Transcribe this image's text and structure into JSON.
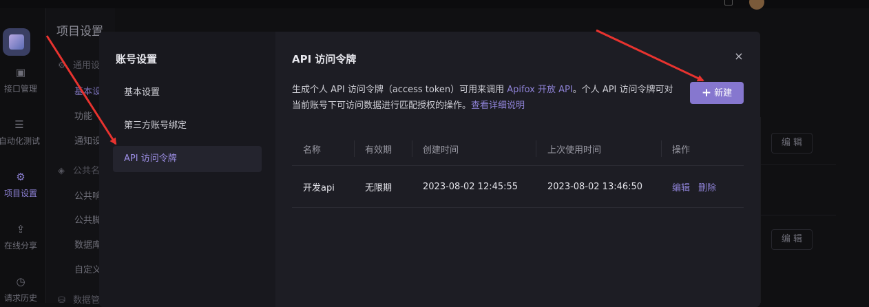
{
  "background": {
    "page_title": "项目设置",
    "nav_items": [
      {
        "label": "接口管理",
        "icon": "api-icon"
      },
      {
        "label": "自动化测试",
        "icon": "automation-icon"
      },
      {
        "label": "项目设置",
        "icon": "settings-icon"
      },
      {
        "label": "在线分享",
        "icon": "share-icon"
      },
      {
        "label": "请求历史",
        "icon": "history-icon"
      }
    ],
    "sub_groups": [
      "通用设",
      "公共名",
      "数据管"
    ],
    "sub_items": [
      "基本设",
      "功能",
      "通知设",
      "公共响",
      "公共脚",
      "数据库",
      "自定义"
    ],
    "edit_buttons": [
      "编 辑",
      "编 辑"
    ]
  },
  "modal": {
    "sidebar_title": "账号设置",
    "sidebar_items": [
      "基本设置",
      "第三方账号绑定",
      "API 访问令牌"
    ],
    "active_item": "API 访问令牌",
    "title": "API 访问令牌",
    "close_label": "×",
    "description": {
      "part1": "生成个人 API 访问令牌（access token）可用来调用 ",
      "link1": "Apifox 开放 API",
      "part2": "。个人 API 访问令牌可对当前账号下可访问数据进行匹配授权的操作。",
      "link2": "查看详细说明"
    },
    "new_button": {
      "icon": "+",
      "label": "新建"
    },
    "table": {
      "headers": [
        "名称",
        "有效期",
        "创建时间",
        "上次使用时间",
        "操作"
      ],
      "rows": [
        {
          "name": "开发api",
          "validity": "无限期",
          "created": "2023-08-02 12:45:55",
          "last_used": "2023-08-02 13:46:50",
          "actions": [
            "编辑",
            "删除"
          ]
        }
      ]
    }
  },
  "colors": {
    "accent": "#8677cf",
    "link": "#8e82d6",
    "modal_bg": "#1d1d24",
    "annotation": "#e8332f"
  }
}
